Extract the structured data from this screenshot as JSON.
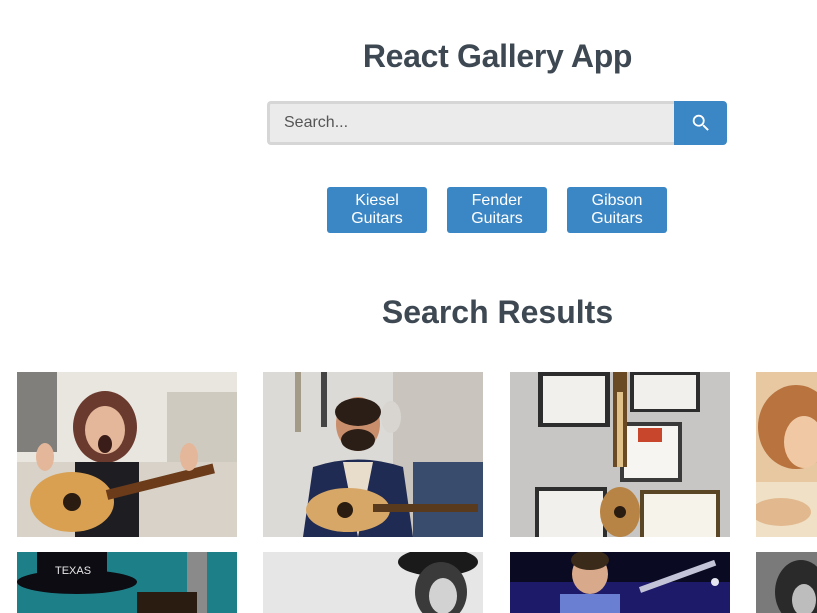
{
  "header": {
    "title": "React Gallery App"
  },
  "search": {
    "placeholder": "Search...",
    "button_icon": "search-icon"
  },
  "nav": {
    "items": [
      {
        "label": "Kiesel Guitars"
      },
      {
        "label": "Fender Guitars"
      },
      {
        "label": "Gibson Guitars"
      }
    ]
  },
  "results": {
    "title": "Search Results"
  },
  "colors": {
    "accent": "#3b86c4",
    "heading": "#3d4852",
    "input_bg": "#ebebeb",
    "input_border": "#d6d6d6"
  }
}
